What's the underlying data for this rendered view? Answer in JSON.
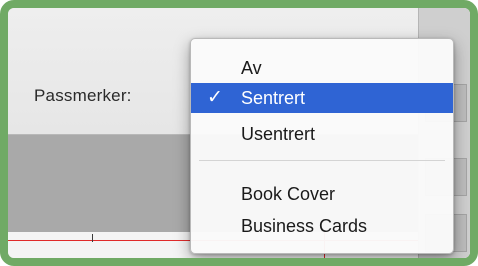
{
  "field": {
    "label": "Passmerker:"
  },
  "menu": {
    "options": [
      {
        "label": "Av"
      },
      {
        "label": "Sentrert",
        "checkmark": "✓"
      },
      {
        "label": "Usentrert"
      },
      {
        "label": "Book Cover"
      },
      {
        "label": "Business Cards"
      }
    ],
    "selected_index": 1
  },
  "colors": {
    "frame_border": "#70aa65",
    "highlight": "#2f64d4",
    "red_guide": "#e02a2a"
  }
}
